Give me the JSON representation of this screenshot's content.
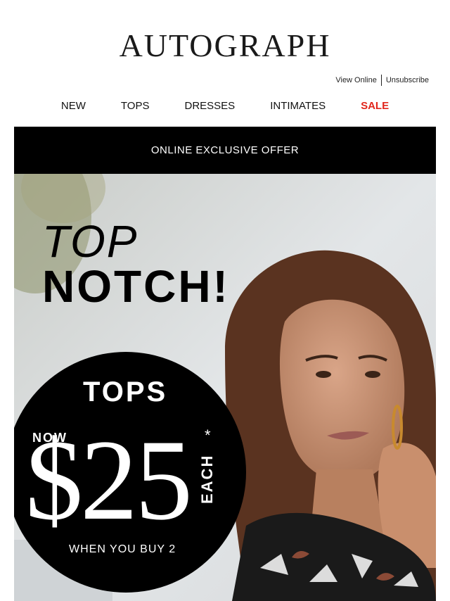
{
  "brand": {
    "logo_text": "AUTOGRAPH"
  },
  "header_links": {
    "view_online": "View Online",
    "unsubscribe": "Unsubscribe"
  },
  "nav": {
    "items": [
      {
        "label": "NEW"
      },
      {
        "label": "TOPS"
      },
      {
        "label": "DRESSES"
      },
      {
        "label": "INTIMATES"
      },
      {
        "label": "SALE"
      }
    ],
    "sale_color": "#e1261c"
  },
  "banner": {
    "offer_text": "ONLINE EXCLUSIVE OFFER",
    "headline_line1": "TOP",
    "headline_line2": "NOTCH!",
    "promo": {
      "category": "TOPS",
      "now": "NOW",
      "price": "$25",
      "asterisk": "*",
      "each": "EACH",
      "condition": "WHEN YOU BUY 2"
    }
  }
}
